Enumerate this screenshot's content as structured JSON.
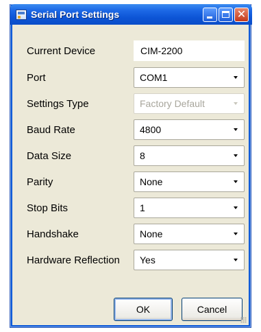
{
  "window": {
    "title": "Serial Port Settings",
    "close_glyph": "✕"
  },
  "fields": {
    "current_device": {
      "label": "Current Device",
      "value": "CIM-2200"
    },
    "port": {
      "label": "Port",
      "value": "COM1"
    },
    "settings_type": {
      "label": "Settings Type",
      "value": "Factory Default",
      "disabled": true
    },
    "baud_rate": {
      "label": "Baud Rate",
      "value": "4800"
    },
    "data_size": {
      "label": "Data Size",
      "value": "8"
    },
    "parity": {
      "label": "Parity",
      "value": "None"
    },
    "stop_bits": {
      "label": "Stop Bits",
      "value": "1"
    },
    "handshake": {
      "label": "Handshake",
      "value": "None"
    },
    "hardware_reflection": {
      "label": "Hardware Reflection",
      "value": "Yes"
    }
  },
  "buttons": {
    "ok": "OK",
    "cancel": "Cancel"
  },
  "icons": {
    "app": "serial-port-app-icon",
    "minimize": "minimize-icon",
    "maximize": "maximize-icon",
    "close": "close-icon",
    "dropdown": "chevron-down-icon",
    "resize": "resize-grip-icon"
  },
  "colors": {
    "titlebar": "#0d55d6",
    "client_background": "#ece9d8",
    "close_button": "#c4391a",
    "disabled_text": "#a8a69c"
  }
}
